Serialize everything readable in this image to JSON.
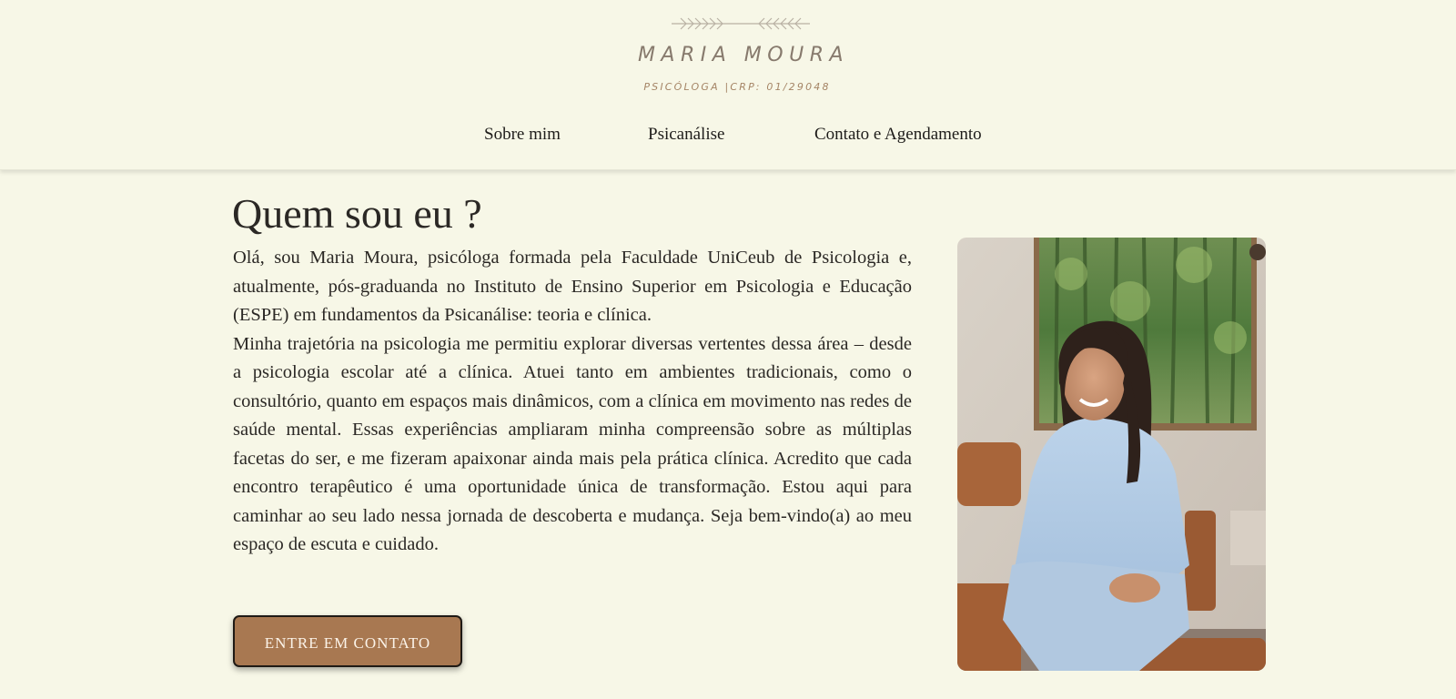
{
  "header": {
    "logo_name": "MARIA MOURA",
    "logo_subtitle": "PSICÓLOGA |CRP: 01/29048",
    "logo_icon": "leaf-branch-ornament"
  },
  "nav": {
    "items": [
      {
        "label": "Sobre mim"
      },
      {
        "label": "Psicanálise"
      },
      {
        "label": "Contato e Agendamento"
      }
    ]
  },
  "main": {
    "title": "Quem sou eu ?",
    "paragraphs": [
      "Olá, sou Maria Moura, psicóloga formada pela Faculdade UniCeub de Psicologia e, atualmente, pós-graduanda no Instituto de Ensino Superior em Psicologia e Educação (ESPE) em fundamentos da Psicanálise: teoria e clínica.",
      "Minha trajetória na psicologia me permitiu explorar diversas vertentes dessa área – desde a psicologia escolar até a clínica. Atuei tanto em ambientes tradicionais, como o consultório, quanto em espaços mais dinâmicos, com a clínica em movimento nas redes de saúde mental. Essas experiências ampliaram minha compreensão sobre as múltiplas facetas do ser, e me fizeram apaixonar ainda mais pela prática clínica. Acredito que cada encontro terapêutico é uma oportunidade única de transformação. Estou aqui para caminhar ao seu lado nessa jornada de descoberta e mudança. Seja bem-vindo(a) ao meu espaço de escuta e cuidado."
    ],
    "cta_label": "ENTRE EM CONTATO"
  },
  "colors": {
    "background": "#f7f7e7",
    "button": "#a87851",
    "logo_text": "#877a6d",
    "logo_subtitle": "#a58566"
  }
}
